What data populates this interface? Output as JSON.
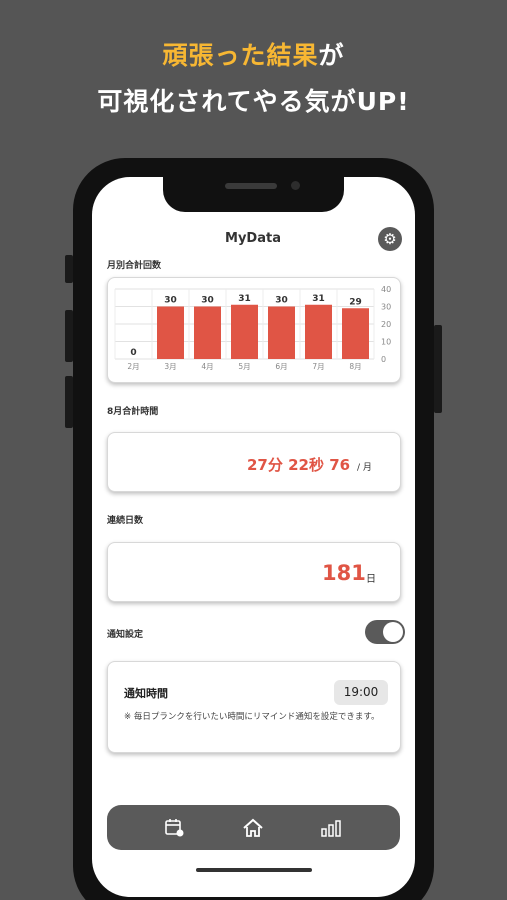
{
  "promo": {
    "line1_accent": "頑張った結果",
    "line1_rest": "が",
    "line2": "可視化されてやる気がUP!"
  },
  "header": {
    "title": "MyData",
    "settings_icon": "gear-icon"
  },
  "monthly": {
    "label": "月別合計回数",
    "chart_data": {
      "type": "bar",
      "categories": [
        "2月",
        "3月",
        "4月",
        "5月",
        "6月",
        "7月",
        "8月"
      ],
      "values": [
        0,
        30,
        30,
        31,
        30,
        31,
        29
      ],
      "data_labels": [
        "0",
        "30",
        "30",
        "31",
        "30",
        "31",
        "29"
      ],
      "ylim": [
        0,
        40
      ],
      "yticks": [
        "0",
        "10",
        "20",
        "30",
        "40"
      ],
      "y_axis_side": "right",
      "grid": true,
      "bar_color": "#e05545"
    }
  },
  "total_time": {
    "label": "8月合計時間",
    "value": "27分  22秒 76",
    "unit": "/ 月"
  },
  "streak": {
    "label": "連続日数",
    "value": "181",
    "unit": "日"
  },
  "notification": {
    "label": "通知設定",
    "enabled": true,
    "title": "通知時間",
    "time": "19:00",
    "description": "※ 毎日プランクを行いたい時間にリマインド通知を設定できます。"
  },
  "tabbar": {
    "items": [
      {
        "icon": "calendar-icon"
      },
      {
        "icon": "home-icon"
      },
      {
        "icon": "bar-chart-icon"
      }
    ]
  },
  "colors": {
    "accent": "#f7b733",
    "value_red": "#e05545",
    "dark": "#5a5a5a"
  }
}
